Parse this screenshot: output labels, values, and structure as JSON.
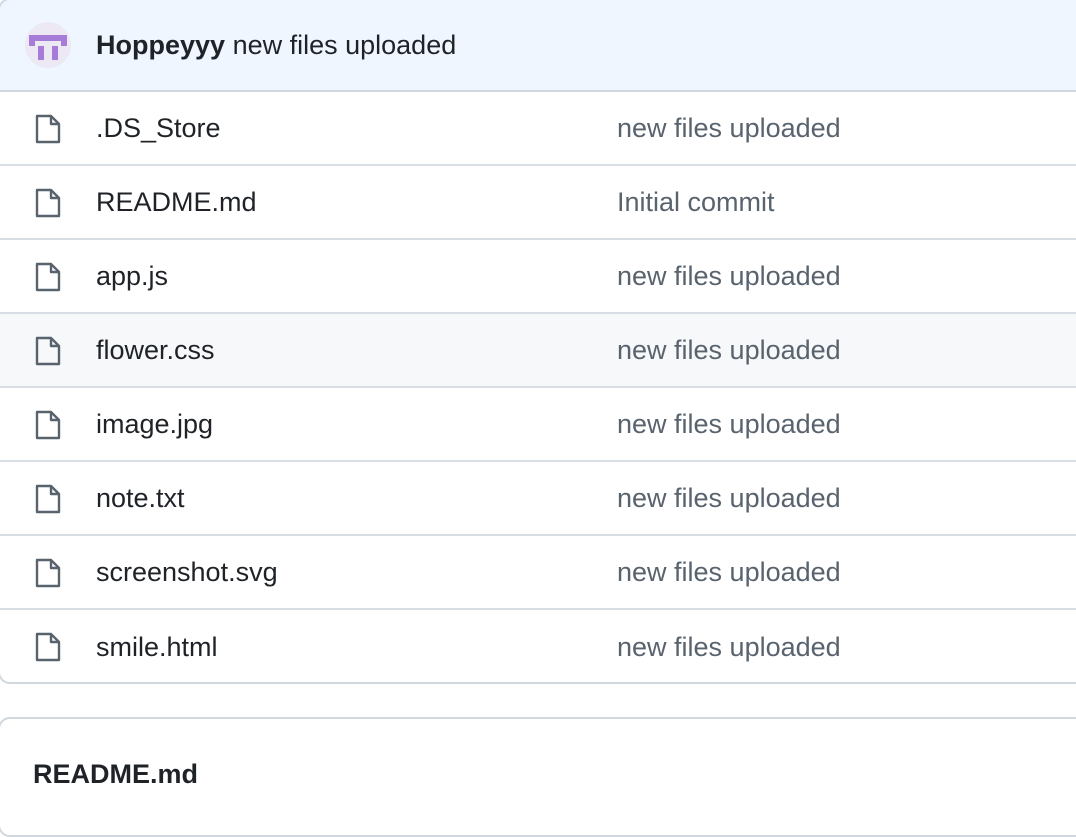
{
  "commit": {
    "author": "Hoppeyyy",
    "message": "new files uploaded",
    "avatar_icon": "user-avatar"
  },
  "files": [
    {
      "name": ".DS_Store",
      "message": "new files uploaded",
      "icon": "file-icon"
    },
    {
      "name": "README.md",
      "message": "Initial commit",
      "icon": "file-icon"
    },
    {
      "name": "app.js",
      "message": "new files uploaded",
      "icon": "file-icon"
    },
    {
      "name": "flower.css",
      "message": "new files uploaded",
      "icon": "file-icon"
    },
    {
      "name": "image.jpg",
      "message": "new files uploaded",
      "icon": "file-icon"
    },
    {
      "name": "note.txt",
      "message": "new files uploaded",
      "icon": "file-icon"
    },
    {
      "name": "screenshot.svg",
      "message": "new files uploaded",
      "icon": "file-icon"
    },
    {
      "name": "smile.html",
      "message": "new files uploaded",
      "icon": "file-icon"
    }
  ],
  "readme": {
    "title": "README.md"
  },
  "colors": {
    "header_bg": "#f0f6ff",
    "hover_row_bg": "#f6f8fa",
    "border": "#d0d7de",
    "avatar_accent": "#a77bd8"
  }
}
